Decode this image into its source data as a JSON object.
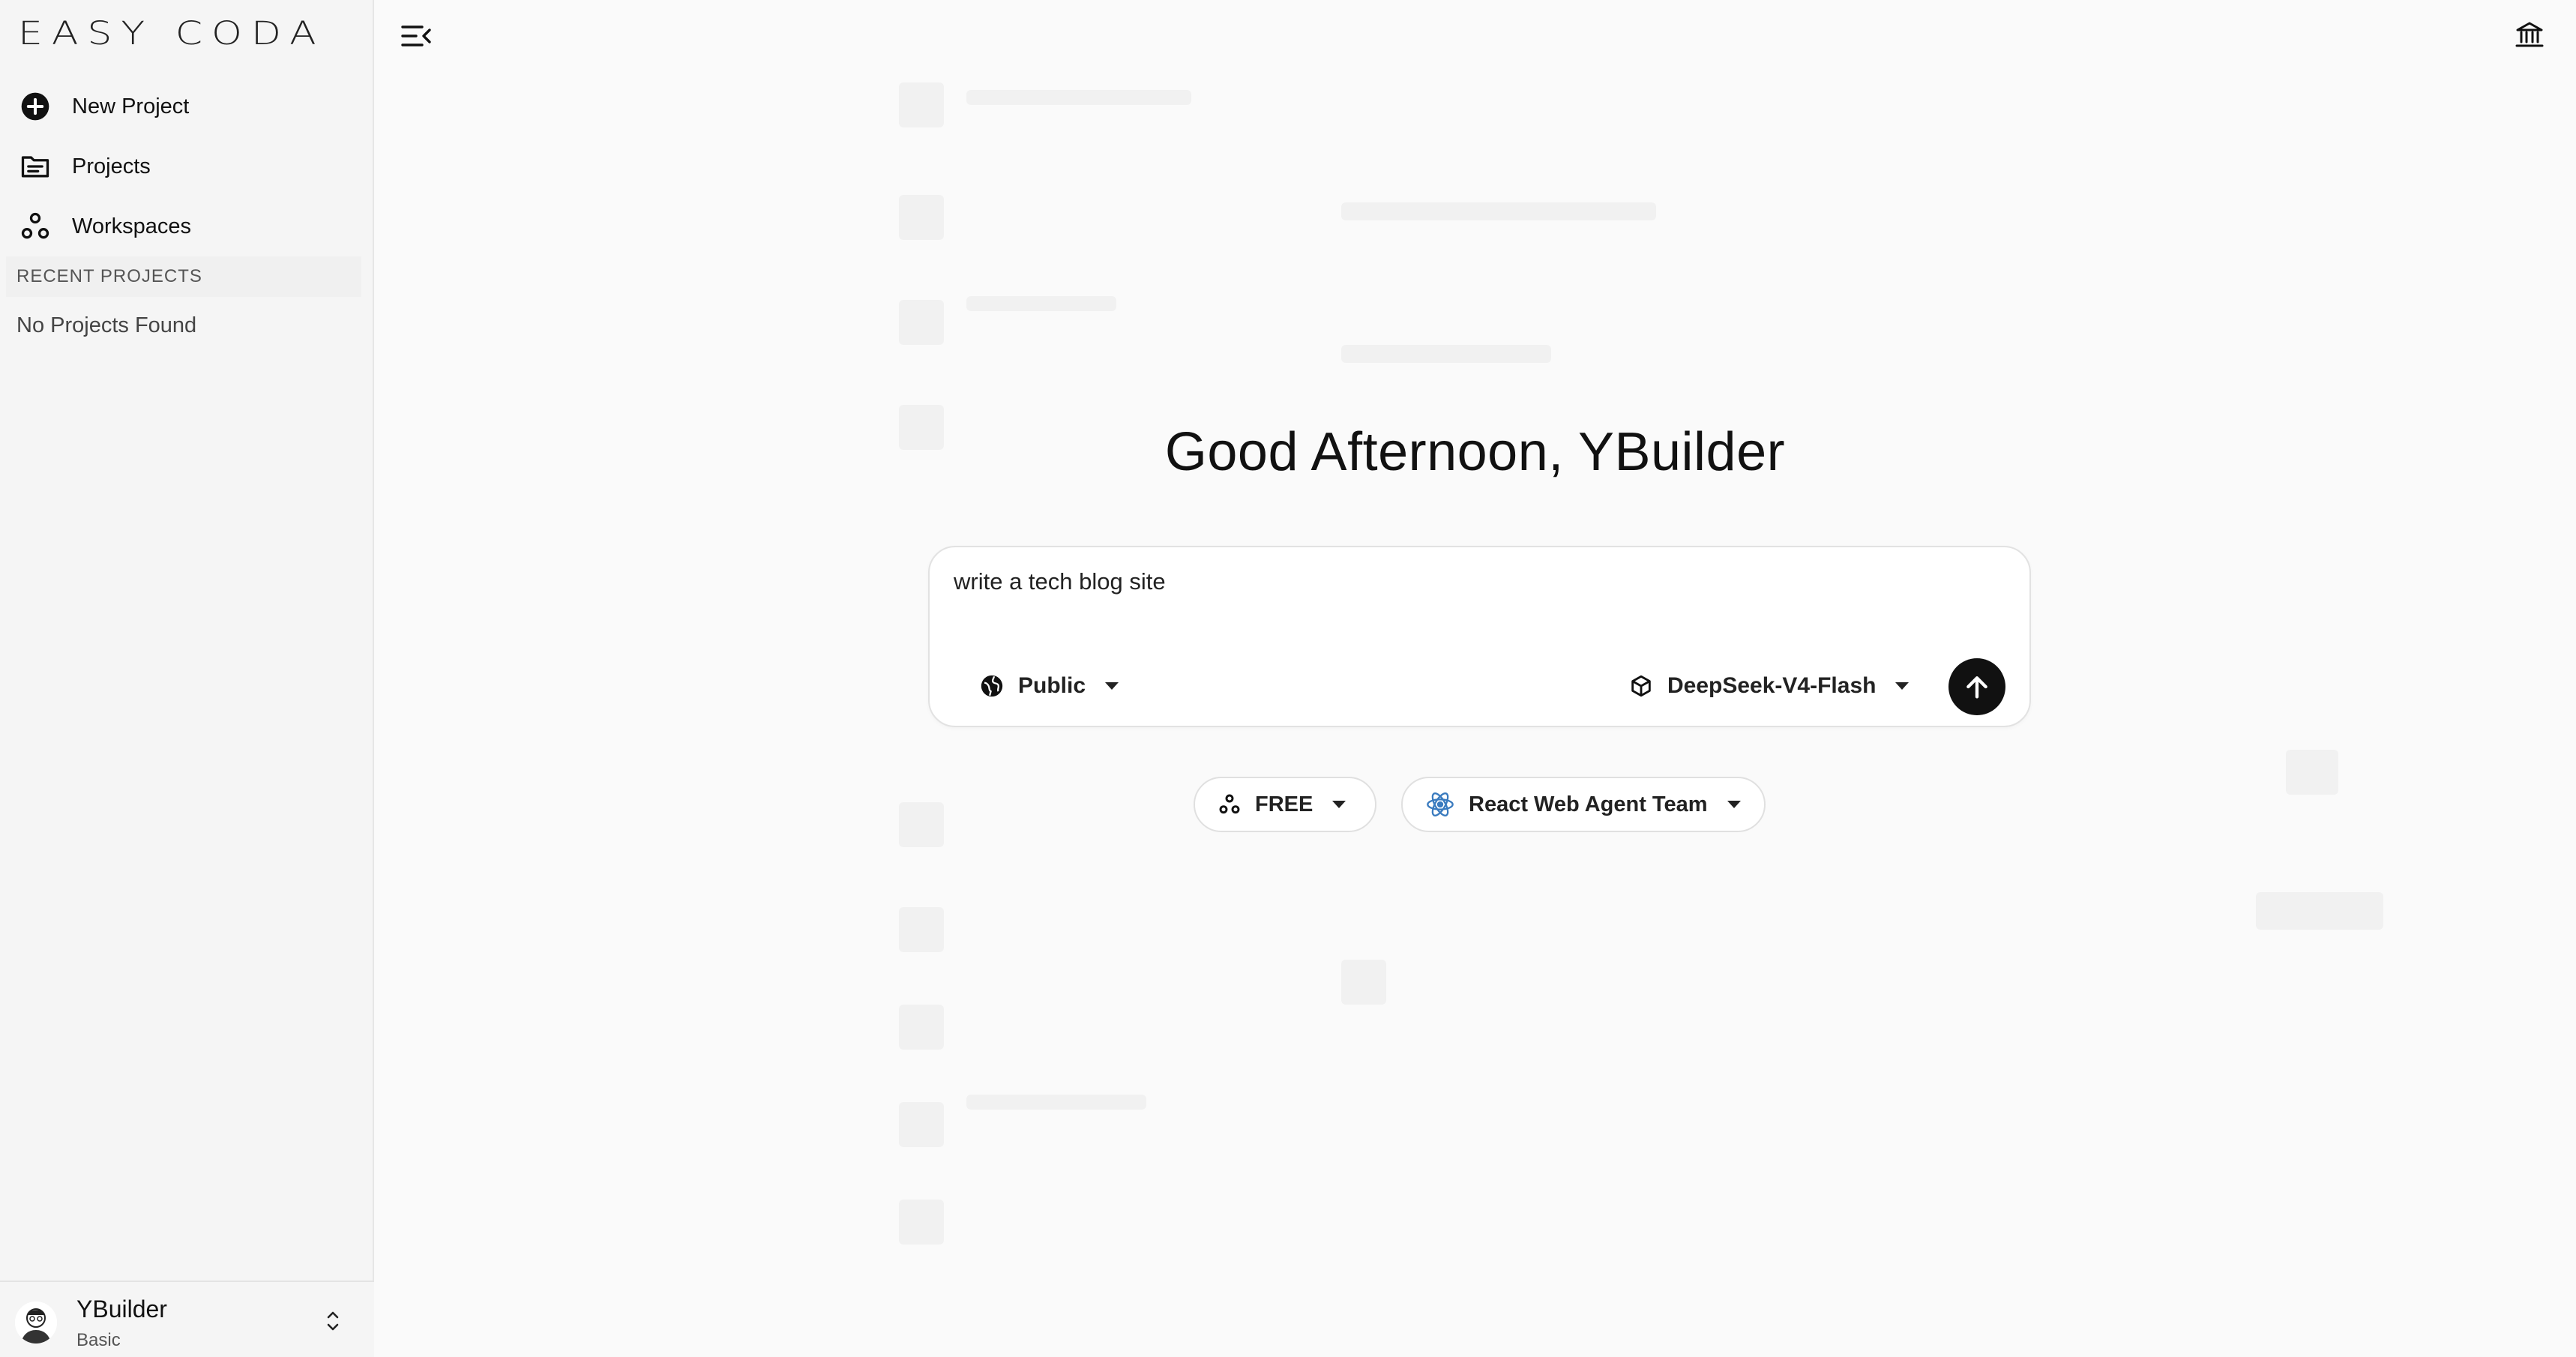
{
  "sidebar": {
    "logo_text": "EASY CODA",
    "nav": [
      {
        "label": "New Project",
        "icon": "plus-circle-icon"
      },
      {
        "label": "Projects",
        "icon": "folder-icon"
      },
      {
        "label": "Workspaces",
        "icon": "workspaces-icon"
      }
    ],
    "recent_header": "RECENT PROJECTS",
    "empty_text": "No Projects Found",
    "user": {
      "name": "YBuilder",
      "plan": "Basic"
    }
  },
  "main": {
    "greeting": "Good Afternoon, YBuilder",
    "prompt_value": "write a tech blog site",
    "visibility": "Public",
    "model": "DeepSeek-V4-Flash",
    "tier": "FREE",
    "team": "React Web Agent Team"
  },
  "colors": {
    "accent": "#111111",
    "background": "#fafafa",
    "sidebar": "#f5f5f5"
  }
}
